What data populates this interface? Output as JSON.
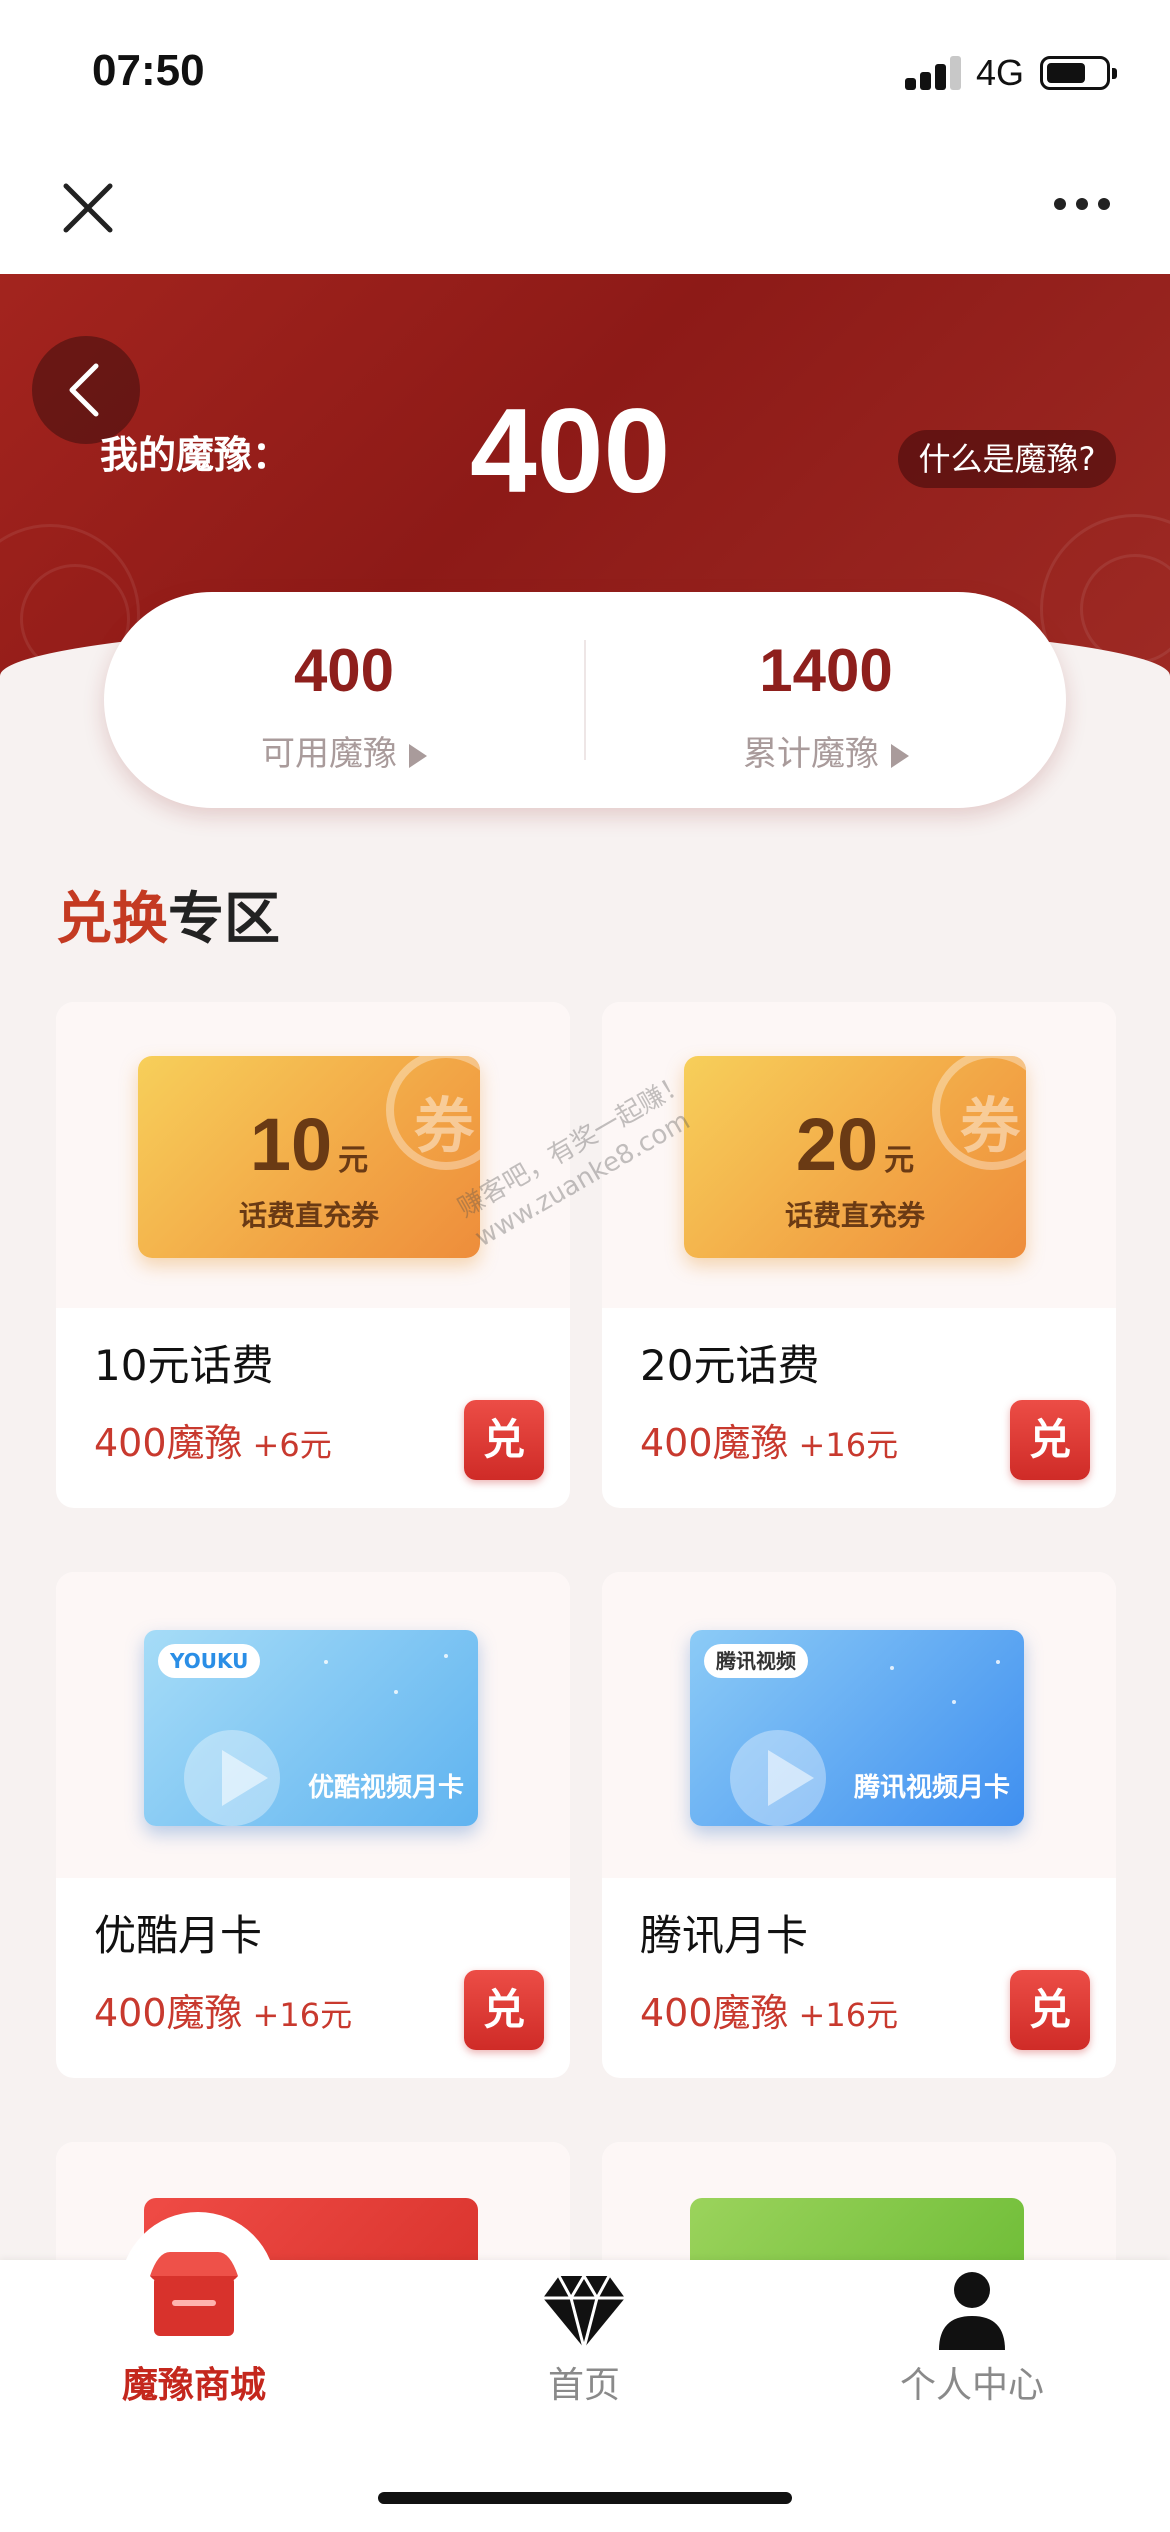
{
  "status_bar": {
    "time": "07:50",
    "network": "4G"
  },
  "nav": {
    "close_icon": "close-icon",
    "more_icon": "more-icon"
  },
  "header": {
    "my_label": "我的魔豫：",
    "my_value": "400",
    "what_label": "什么是魔豫?",
    "accent_color": "#8d1a17"
  },
  "stats": {
    "available": {
      "value": "400",
      "label": "可用魔豫"
    },
    "total": {
      "value": "1400",
      "label": "累计魔豫"
    }
  },
  "section": {
    "title_accent": "兑换",
    "title_rest": "专区"
  },
  "products": [
    {
      "name": "10元话费",
      "price": "400魔豫",
      "bonus": "+6元",
      "redeem": "兑",
      "card_amount": "10",
      "card_unit": "元",
      "card_sub": "话费直充券",
      "card_mark": "券"
    },
    {
      "name": "20元话费",
      "price": "400魔豫",
      "bonus": "+16元",
      "redeem": "兑",
      "card_amount": "20",
      "card_unit": "元",
      "card_sub": "话费直充券",
      "card_mark": "券"
    },
    {
      "name": "优酷月卡",
      "price": "400魔豫",
      "bonus": "+16元",
      "redeem": "兑",
      "card_badge": "YOUKU",
      "card_label": "优酷视频月卡"
    },
    {
      "name": "腾讯月卡",
      "price": "400魔豫",
      "bonus": "+16元",
      "redeem": "兑",
      "card_badge": "腾讯视频",
      "card_label": "腾讯视频月卡"
    }
  ],
  "watermark": {
    "line1": "赚客吧，有奖一起赚！",
    "line2": "www.zuanke8.com"
  },
  "tabs": [
    {
      "label": "魔豫商城",
      "icon": "store-icon",
      "active": true
    },
    {
      "label": "首页",
      "icon": "diamond-icon",
      "active": false
    },
    {
      "label": "个人中心",
      "icon": "person-icon",
      "active": false
    }
  ]
}
